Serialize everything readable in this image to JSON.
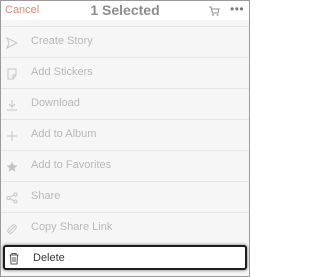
{
  "header": {
    "cancel_label": "Cancel",
    "title": "1 Selected",
    "cart_icon": "cart-icon",
    "more_label": "•••"
  },
  "menu": {
    "items": [
      {
        "label": "Create Story",
        "icon": "story-icon"
      },
      {
        "label": "Add Stickers",
        "icon": "sticker-icon"
      },
      {
        "label": "Download",
        "icon": "download-icon"
      },
      {
        "label": "Add to Album",
        "icon": "plus-icon"
      },
      {
        "label": "Add to Favorites",
        "icon": "star-icon"
      },
      {
        "label": "Share",
        "icon": "share-icon"
      },
      {
        "label": "Copy Share Link",
        "icon": "link-icon"
      },
      {
        "label": "Delete",
        "icon": "trash-icon"
      }
    ]
  },
  "colors": {
    "accent": "#e8837a",
    "disabled_text": "#b8b8b8",
    "active_text": "#3a3a3a"
  }
}
